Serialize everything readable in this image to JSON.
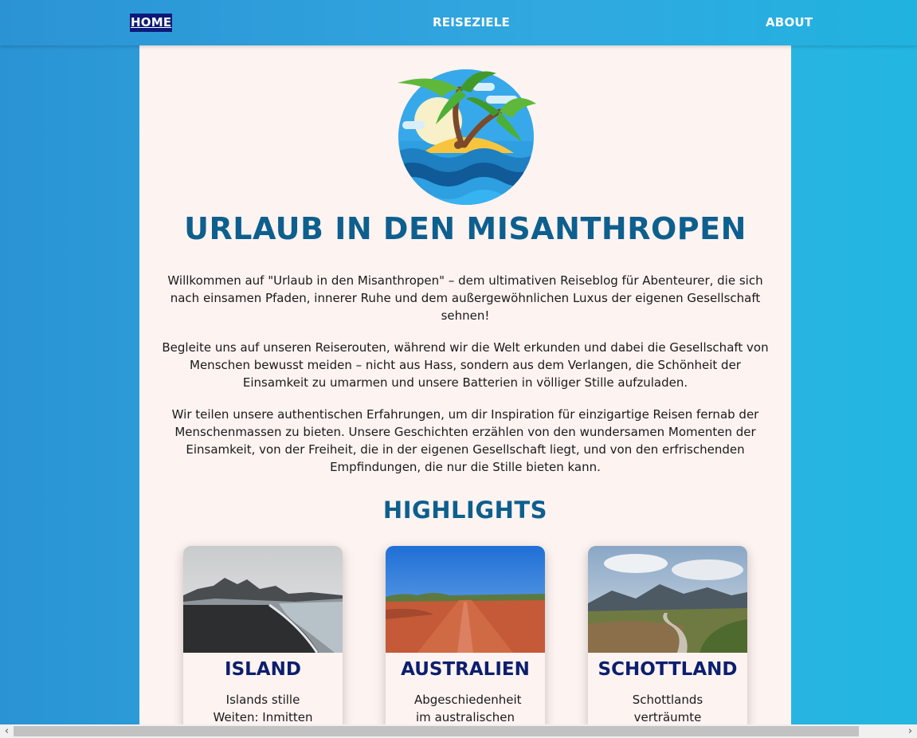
{
  "nav": {
    "home": "Home",
    "reiseziele": "Reiseziele",
    "about": "About"
  },
  "site": {
    "title": "Urlaub in den Misanthropen",
    "logo_icon": "palm-island-icon"
  },
  "intro": {
    "p1": "Willkommen auf \"Urlaub in den Misanthropen\" – dem ultimativen Reiseblog für Abenteurer, die sich nach einsamen Pfaden, innerer Ruhe und dem außergewöhnlichen Luxus der eigenen Gesellschaft sehnen!",
    "p2": "Begleite uns auf unseren Reiserouten, während wir die Welt erkunden und dabei die Gesellschaft von Menschen bewusst meiden – nicht aus Hass, sondern aus dem Verlangen, die Schönheit der Einsamkeit zu umarmen und unsere Batterien in völliger Stille aufzuladen.",
    "p3": "Wir teilen unsere authentischen Erfahrungen, um dir Inspiration für einzigartige Reisen fernab der Menschenmassen zu bieten. Unsere Geschichten erzählen von den wundersamen Momenten der Einsamkeit, von der Freiheit, die in der eigenen Gesellschaft liegt, und von den erfrischenden Empfindungen, die nur die Stille bieten kann."
  },
  "highlights": {
    "heading": "Highlights",
    "cards": [
      {
        "title": "Island",
        "text": "Islands stille Weiten: Inmitten"
      },
      {
        "title": "Australien",
        "text": "Abgeschiedenheit im australischen"
      },
      {
        "title": "Schottland",
        "text": "Schottlands verträumte"
      }
    ]
  },
  "colors": {
    "nav_active_bg": "#0b1a78",
    "title_color": "#0d5f8e",
    "card_title_color": "#0c1f6e",
    "content_bg": "#fdf3f1"
  }
}
